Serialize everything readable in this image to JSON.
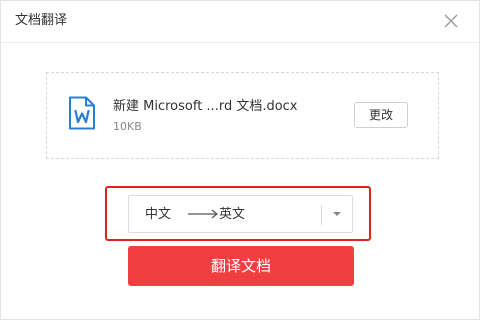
{
  "dialog": {
    "title": "文档翻译"
  },
  "file": {
    "name": "新建 Microsoft ...rd 文档.docx",
    "size": "10KB",
    "change_label": "更改",
    "icon": "word-doc-icon"
  },
  "language": {
    "source": "中文",
    "target": "英文"
  },
  "actions": {
    "translate_label": "翻译文档"
  },
  "colors": {
    "accent": "#f13f41",
    "highlight": "#e0231c",
    "icon_blue": "#2b7cd3"
  }
}
